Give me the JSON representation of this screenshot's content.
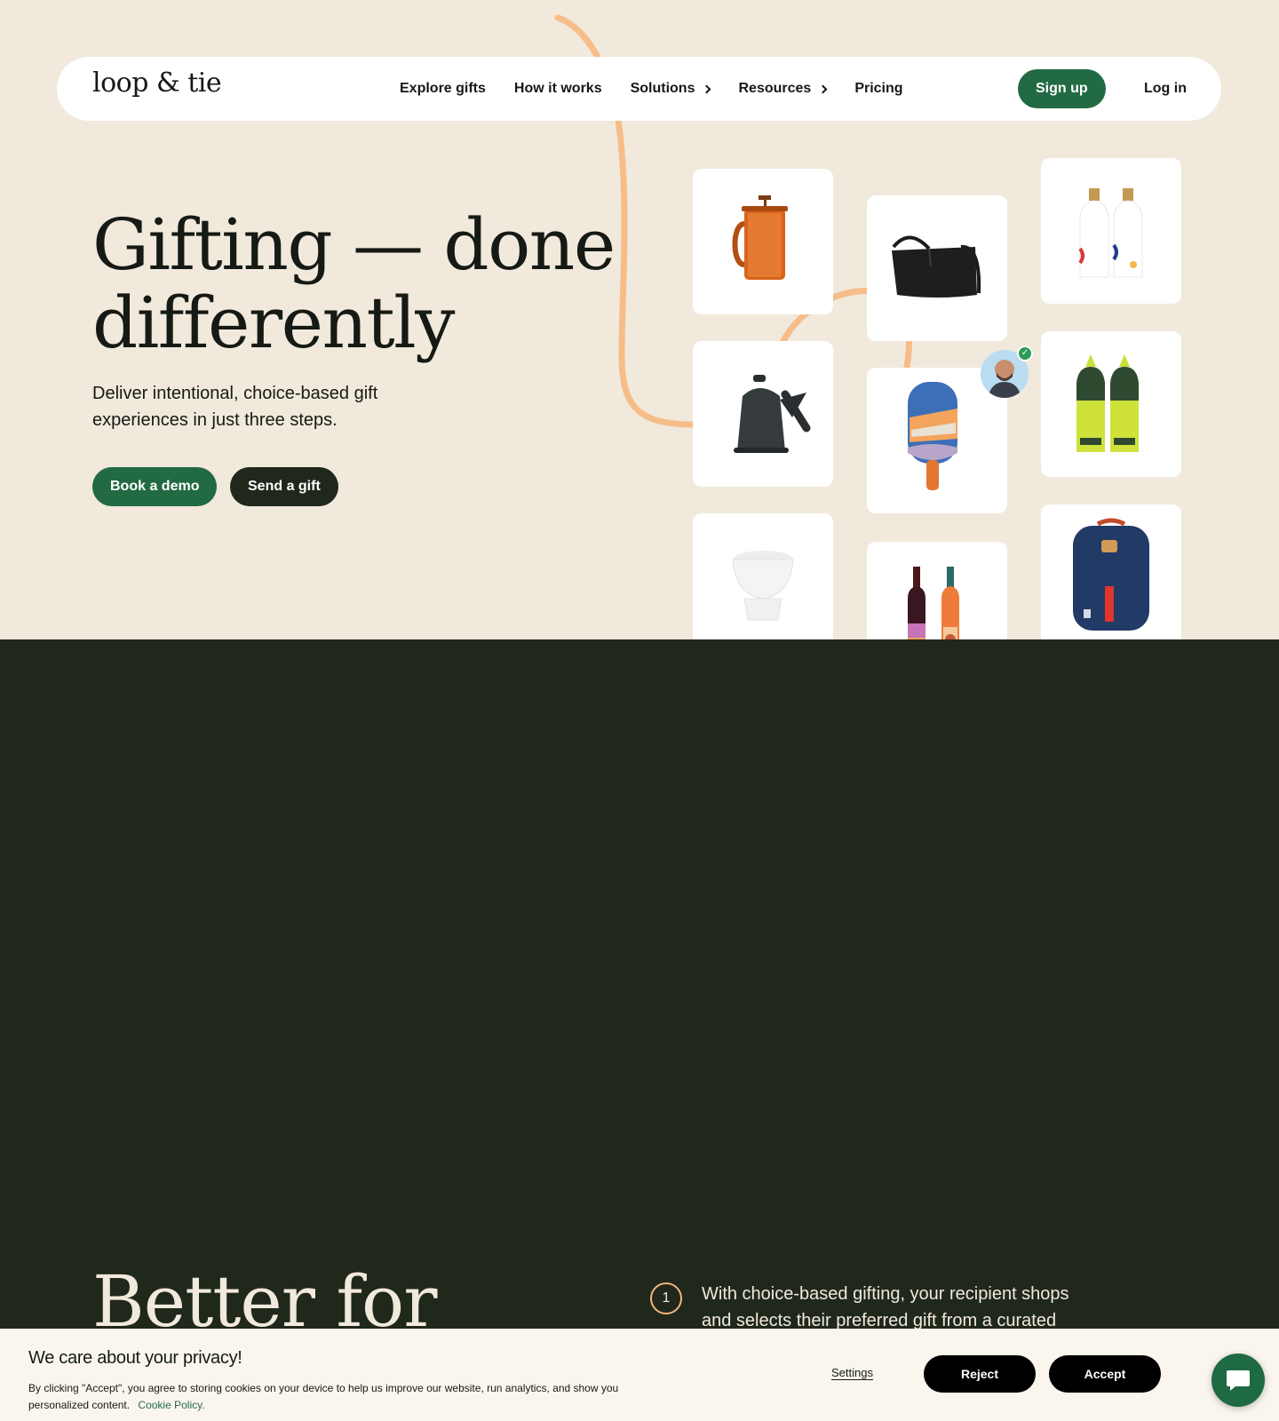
{
  "brand": {
    "logo_text": "loop & tie"
  },
  "nav": {
    "items": [
      {
        "label": "Explore gifts",
        "has_submenu": false
      },
      {
        "label": "How it works",
        "has_submenu": false
      },
      {
        "label": "Solutions",
        "has_submenu": true
      },
      {
        "label": "Resources",
        "has_submenu": true
      },
      {
        "label": "Pricing",
        "has_submenu": false
      }
    ],
    "signup_label": "Sign up",
    "login_label": "Log in"
  },
  "hero": {
    "headline_line1": "Gifting — done",
    "headline_line2": "differently",
    "subhead": "Deliver intentional, choice-based gift experiences in just three steps.",
    "primary_cta": "Book a demo",
    "secondary_cta": "Send a gift",
    "products": [
      {
        "icon": "french-press-icon"
      },
      {
        "icon": "tote-bag-icon"
      },
      {
        "icon": "olive-oil-bottles-icon"
      },
      {
        "icon": "kettle-icon"
      },
      {
        "icon": "pickleball-paddle-icon"
      },
      {
        "icon": "hot-sauce-bottles-icon"
      },
      {
        "icon": "ceramic-bowl-icon"
      },
      {
        "icon": "wine-bottles-icon"
      },
      {
        "icon": "backpack-icon"
      }
    ]
  },
  "section": {
    "title": "Better for",
    "step_number": "1",
    "step_text": "With choice-based gifting, your recipient shops and selects their preferred gift from a curated"
  },
  "cookie": {
    "title": "We care about your privacy!",
    "body": "By clicking \"Accept\", you agree to storing cookies on your device to help us improve our website, run analytics, and show you personalized content.",
    "policy_link": "Cookie Policy.",
    "settings_label": "Settings",
    "reject_label": "Reject",
    "accept_label": "Accept"
  },
  "colors": {
    "cream": "#f1e9dc",
    "green": "#226a43",
    "dark": "#20281c",
    "accent_orange": "#f2b67c"
  }
}
